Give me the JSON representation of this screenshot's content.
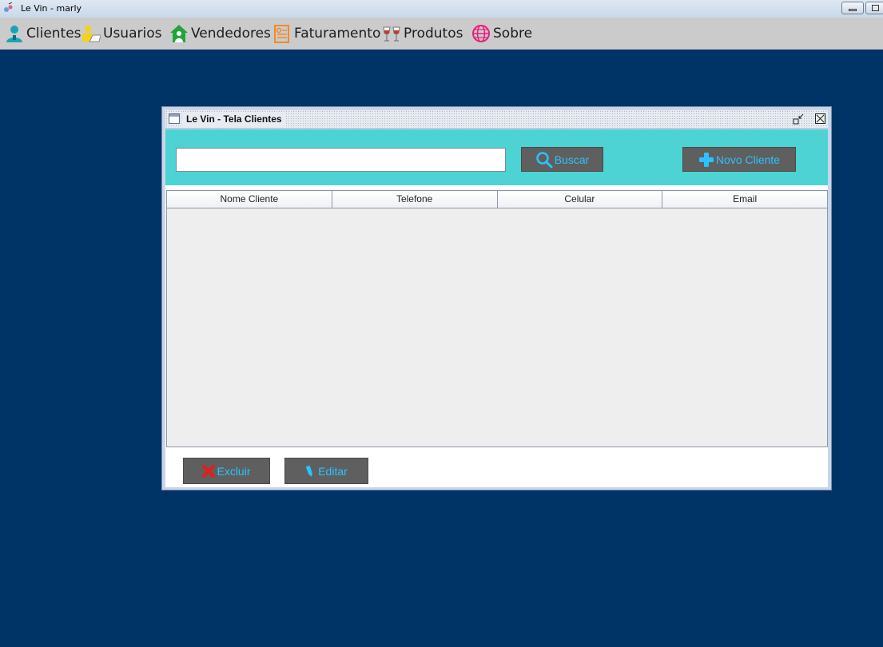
{
  "window": {
    "title": "Le Vin - marly"
  },
  "menu": [
    {
      "label": "Clientes",
      "icon": "client-user-icon",
      "color": "#1aa3b8"
    },
    {
      "label": "Usuarios",
      "icon": "user-laptop-icon",
      "color": "#f3d21b"
    },
    {
      "label": "Vendedores",
      "icon": "house-seller-icon",
      "color": "#22a43a"
    },
    {
      "label": "Faturamento",
      "icon": "invoice-icon",
      "color": "#f08a2a"
    },
    {
      "label": "Produtos",
      "icon": "wine-glasses-icon",
      "color": "#c0392b"
    },
    {
      "label": "Sobre",
      "icon": "globe-hand-icon",
      "color": "#e91e7d"
    }
  ],
  "clientes_frame": {
    "title": "Le Vin - Tela Clientes",
    "search": {
      "value": "",
      "placeholder": ""
    },
    "buscar_label": "Buscar",
    "novo_cliente_label": "Novo Cliente",
    "table": {
      "columns": [
        "Nome Cliente",
        "Telefone",
        "Celular",
        "Email"
      ],
      "rows": []
    },
    "excluir_label": "Excluir",
    "editar_label": "Editar"
  },
  "colors": {
    "desktop": "#003366",
    "search_panel": "#4dd3d3",
    "button_bg": "#5f5f5f",
    "button_text": "#29c4ff",
    "delete_icon": "#e81b1b"
  }
}
